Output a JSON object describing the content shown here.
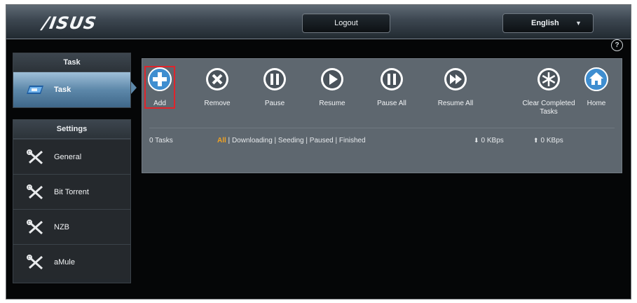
{
  "header": {
    "logo": "/ISUS",
    "logout_label": "Logout",
    "language": "English",
    "language_icon": "chevron-down-icon",
    "help_icon": "help-circle-icon"
  },
  "sidebar": {
    "task_group_title": "Task",
    "task_item": {
      "label": "Task",
      "icon": "task-icon"
    },
    "settings_group_title": "Settings",
    "settings_items": [
      {
        "label": "General",
        "icon": "wrench-icon"
      },
      {
        "label": "Bit Torrent",
        "icon": "wrench-icon"
      },
      {
        "label": "NZB",
        "icon": "wrench-icon"
      },
      {
        "label": "aMule",
        "icon": "wrench-icon"
      }
    ]
  },
  "toolbar": {
    "buttons": [
      {
        "label": "Add",
        "icon": "plus-icon"
      },
      {
        "label": "Remove",
        "icon": "x-icon"
      },
      {
        "label": "Pause",
        "icon": "pause-icon"
      },
      {
        "label": "Resume",
        "icon": "play-icon"
      },
      {
        "label": "Pause All",
        "icon": "pause-all-icon"
      },
      {
        "label": "Resume All",
        "icon": "resume-all-icon"
      },
      {
        "label": "Clear Completed Tasks",
        "icon": "snowflake-icon"
      },
      {
        "label": "Home",
        "icon": "home-icon"
      }
    ]
  },
  "status_bar": {
    "task_count": "0 Tasks",
    "filters": [
      "All",
      "Downloading",
      "Seeding",
      "Paused",
      "Finished"
    ],
    "separator": " | ",
    "download_speed": "0 KBps",
    "upload_speed": "0 KBps"
  },
  "colors": {
    "accent_orange": "#f0a223",
    "highlight_red": "#e0242b",
    "icon_blue": "#3f8ed0"
  }
}
